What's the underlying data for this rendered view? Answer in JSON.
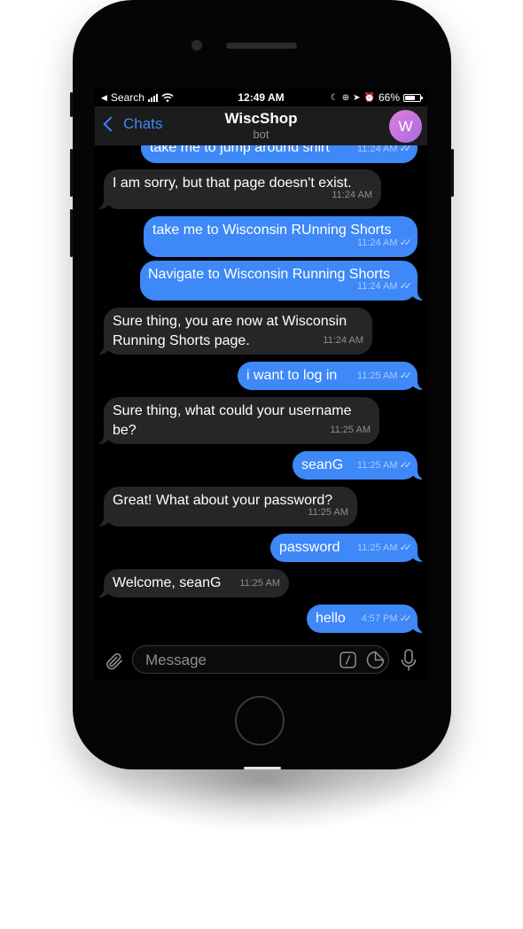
{
  "status_bar": {
    "back_app": "Search",
    "time": "12:49 AM",
    "battery": "66%"
  },
  "nav": {
    "back_label": "Chats",
    "title": "WiscShop",
    "subtitle": "bot",
    "avatar_letter": "W"
  },
  "messages": [
    {
      "dir": "out",
      "text": "take me to jump around shirt",
      "time": "11:24 AM"
    },
    {
      "dir": "in",
      "text": "I am sorry, but that page doesn't exist.",
      "time": "11:24 AM"
    },
    {
      "dir": "out",
      "text": "take me to Wisconsin RUnning Shorts",
      "time": "11:24 AM"
    },
    {
      "dir": "out",
      "text": "Navigate to Wisconsin Running Shorts",
      "time": "11:24 AM"
    },
    {
      "dir": "in",
      "text": "Sure thing, you are now at Wisconsin Running Shorts page.",
      "time": "11:24 AM"
    },
    {
      "dir": "out",
      "text": "i want to log in",
      "time": "11:25 AM"
    },
    {
      "dir": "in",
      "text": "Sure thing, what could your username be?",
      "time": "11:25 AM"
    },
    {
      "dir": "out",
      "text": "seanG",
      "time": "11:25 AM"
    },
    {
      "dir": "in",
      "text": "Great! What about your password?",
      "time": "11:25 AM"
    },
    {
      "dir": "out",
      "text": "password",
      "time": "11:25 AM"
    },
    {
      "dir": "in",
      "text": "Welcome, seanG",
      "time": "11:25 AM"
    },
    {
      "dir": "out",
      "text": "hello",
      "time": "4:57 PM"
    }
  ],
  "input": {
    "placeholder": "Message"
  },
  "icons": {
    "attach": "paperclip-icon",
    "commands": "slash-command-icon",
    "sticker": "sticker-icon",
    "mic": "microphone-icon"
  },
  "colors": {
    "accent": "#3e88f7",
    "incoming_bubble": "#262628",
    "nav_background": "#1c1c1d",
    "avatar": "#c775de"
  }
}
